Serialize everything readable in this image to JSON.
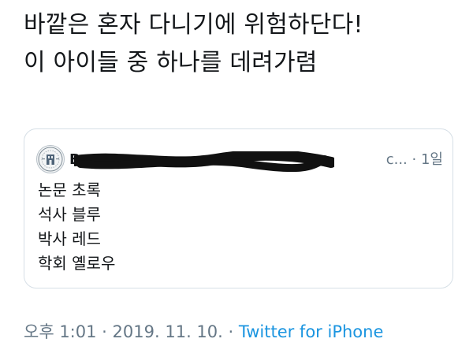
{
  "tweet": {
    "text_lines": [
      "바깥은 혼자 다니기에 위험하단다!",
      "이 아이들 중 하나를 데려가렴"
    ]
  },
  "quoted_tweet": {
    "avatar_icon": "university-seal-icon",
    "author_visible_prefix": "B",
    "author_visible_suffix": "c...",
    "separator": "·",
    "time_ago": "1일",
    "redaction_color": "#111111",
    "lines": [
      "논문 초록",
      "석사 블루",
      "박사 레드",
      "학회 옐로우"
    ]
  },
  "footer": {
    "time": "오후 1:01",
    "separator": "·",
    "date": "2019. 11. 10.",
    "source": "Twitter for iPhone",
    "source_color": "#1b95e0"
  }
}
